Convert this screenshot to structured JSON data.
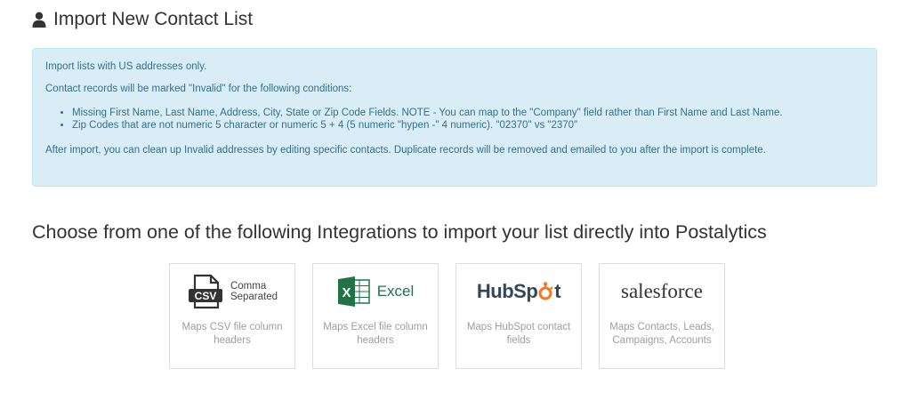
{
  "header": {
    "title": "Import New Contact List",
    "icon": "user-icon"
  },
  "info": {
    "intro": "Import lists with US addresses only.",
    "conditions_intro": "Contact records will be marked \"Invalid\" for the following conditions:",
    "conditions": [
      "Missing First Name, Last Name, Address, City, State or Zip Code Fields. NOTE - You can map to the \"Company\" field rather than First Name and Last Name.",
      "Zip Codes that are not numeric 5 character or numeric 5 + 4 (5 numeric \"hypen -\" 4 numeric). \"02370\" vs \"2370\""
    ],
    "outro": "After import, you can clean up Invalid addresses by editing specific contacts. Duplicate records will be removed and emailed to you after the import is complete."
  },
  "integrations": {
    "title": "Choose from one of the following Integrations to import your list directly into Postalytics",
    "cards": [
      {
        "logo_line1": "Comma",
        "logo_line2": "Separated",
        "icon_text": "CSV",
        "description": "Maps CSV file column headers"
      },
      {
        "logo_text": "Excel",
        "icon_text": "X",
        "description": "Maps Excel file column headers"
      },
      {
        "logo_part1": "HubSp",
        "logo_part2": "t",
        "description": "Maps HubSpot contact fields"
      },
      {
        "logo_text": "salesforce",
        "description": "Maps Contacts, Leads, Campaigns, Accounts"
      }
    ]
  },
  "colors": {
    "info_bg": "#d9edf7",
    "info_text": "#31708f",
    "excel_green": "#217346",
    "hubspot_orange": "#f57722"
  }
}
